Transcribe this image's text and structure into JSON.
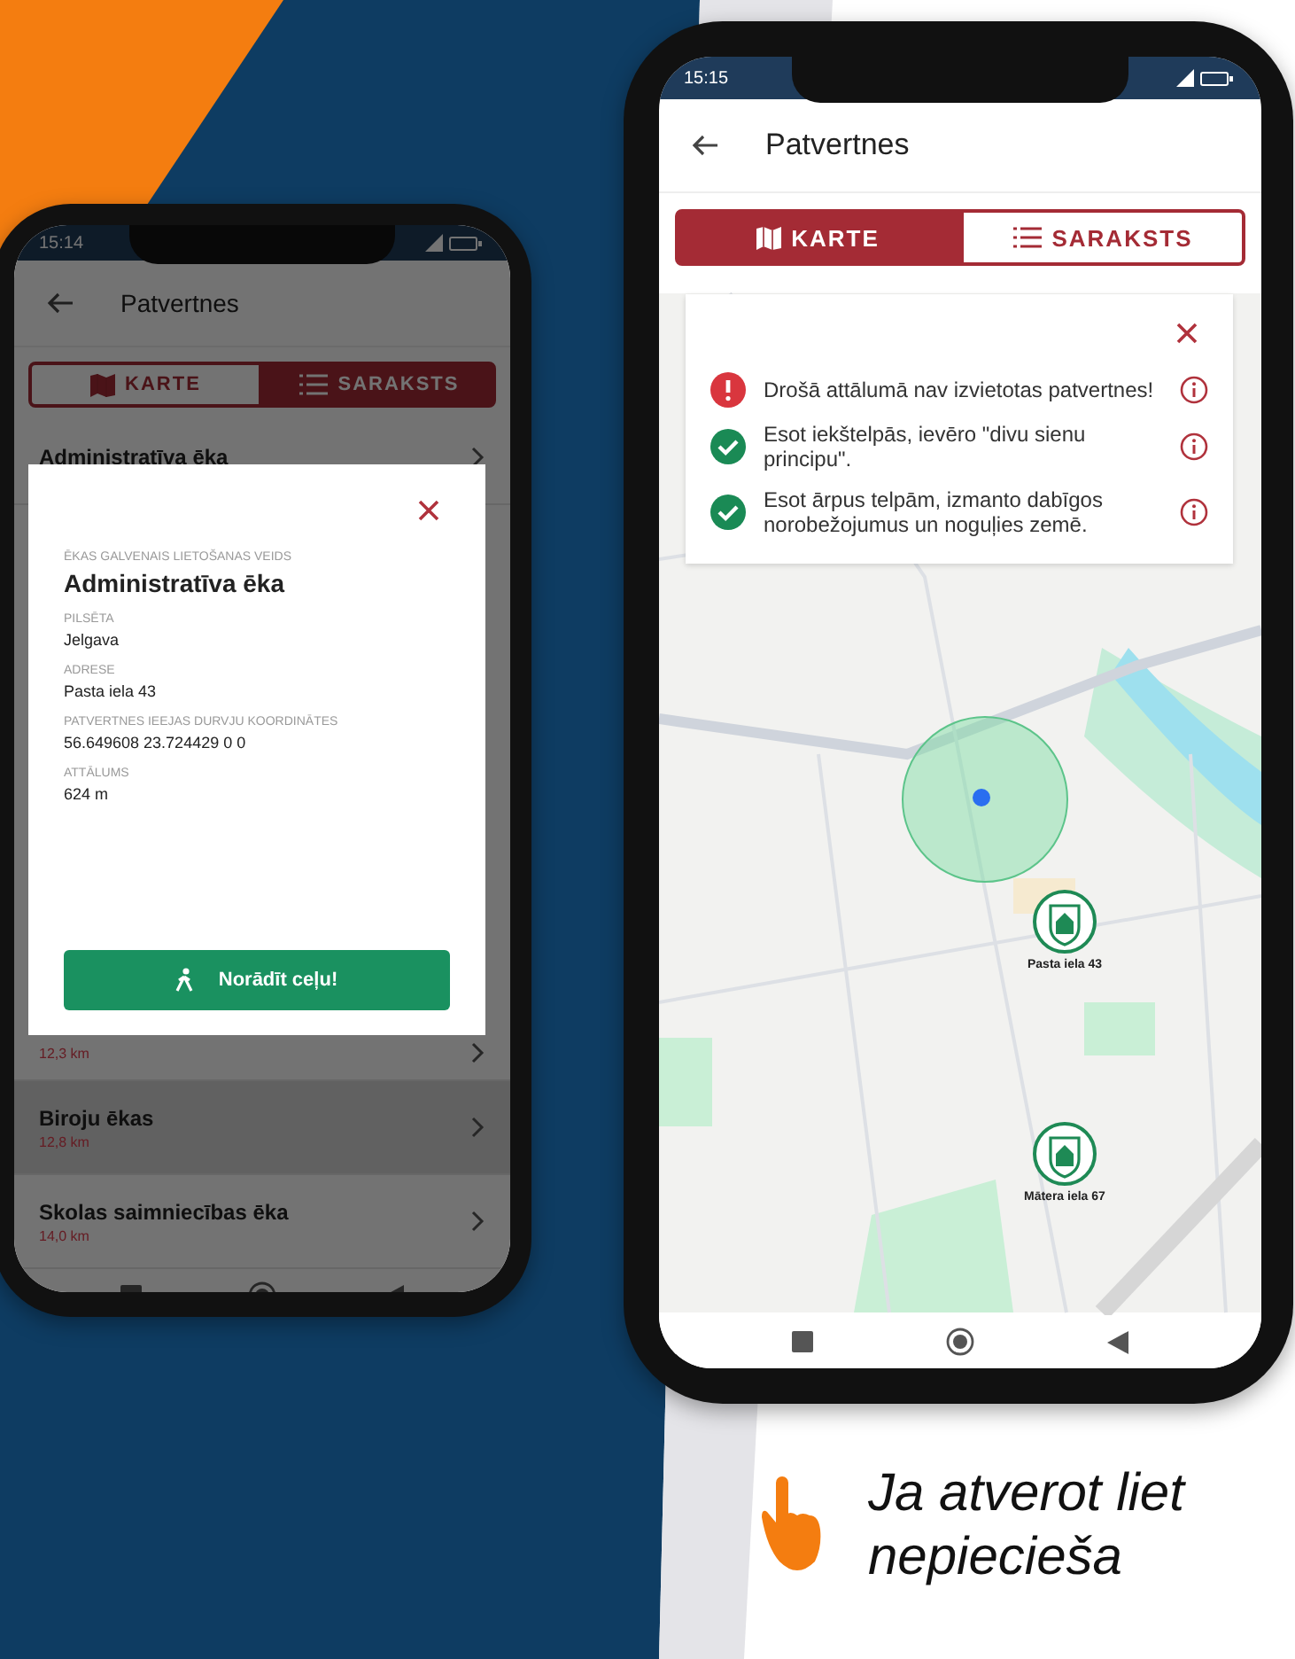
{
  "list_phone": {
    "status_time": "15:14",
    "title": "Patvertnes",
    "tabs": [
      {
        "label": "KARTE",
        "kind": "map",
        "selected": false
      },
      {
        "label": "SARAKSTS",
        "kind": "list",
        "selected": true
      }
    ],
    "shelters": [
      {
        "name": "Administratīva ēka",
        "selected": false
      },
      {
        "distance": "12,3 km",
        "selected": false
      },
      {
        "name": "Biroju ēkas",
        "distance": "12,8 km",
        "selected": true
      },
      {
        "name": "Skolas saimniecības ēka",
        "distance": "14,0 km",
        "selected": false
      }
    ],
    "dialog": {
      "fields": [
        {
          "kind": "heading",
          "label": "ĒKAS GALVENAIS LIETOŠANAS VEIDS",
          "value": "Administratīva ēka"
        },
        {
          "kind": "plain",
          "label": "PILSĒTA",
          "value": "Jelgava"
        },
        {
          "kind": "plain",
          "label": "ADRESE",
          "value": "Pasta iela 43"
        },
        {
          "kind": "plain",
          "label": "PATVERTNES IEEJAS DURVJU KOORDINĀTES",
          "value": "56.649608 23.724429 0 0"
        },
        {
          "kind": "plain",
          "label": "ATTĀLUMS",
          "value": "624 m"
        }
      ],
      "button": "Norādīt ceļu!"
    }
  },
  "map_phone": {
    "status_time": "15:15",
    "title": "Patvertnes",
    "tabs": [
      {
        "label": "KARTE",
        "kind": "map",
        "selected": true
      },
      {
        "label": "SARAKSTS",
        "kind": "list",
        "selected": false
      }
    ],
    "notices": [
      {
        "kind": "alert",
        "text": "Drošā attālumā nav izvietotas patvertnes!"
      },
      {
        "kind": "ok",
        "text": "Esot iekštelpās, ievēro \"divu sienu principu\"."
      },
      {
        "kind": "ok",
        "text": "Esot ārpus telpām, izmanto dabīgos norobežojumus un noguļies zemē."
      }
    ],
    "markers": [
      {
        "label": "Pasta iela 43"
      },
      {
        "label": "Mātera iela 67"
      }
    ]
  },
  "caption": {
    "lines": [
      "Ja atverot liet",
      "nepiecieša"
    ]
  }
}
